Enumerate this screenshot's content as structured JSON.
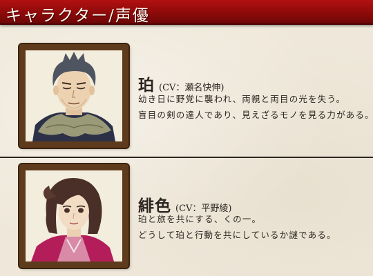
{
  "header": {
    "title": "キャラクター/声優"
  },
  "characters": [
    {
      "name": "珀",
      "cv": "(CV：瀬名快伸)",
      "lines": [
        "幼き日に野党に襲われ、両親と両目の光を失う。",
        "盲目の剣の達人であり、見えざるモノを見る力がある。"
      ],
      "portrait_icon": "portrait-haku"
    },
    {
      "name": "緋色",
      "cv": "(CV：平野綾)",
      "lines": [
        "珀と旅を共にする、くの一。",
        "どうして珀と行動を共にしているか謎である。"
      ],
      "portrait_icon": "portrait-hiiro"
    }
  ],
  "colors": {
    "header_red": "#9a0c0c",
    "frame_brown": "#5e3b1c",
    "paper": "#efe8da"
  }
}
